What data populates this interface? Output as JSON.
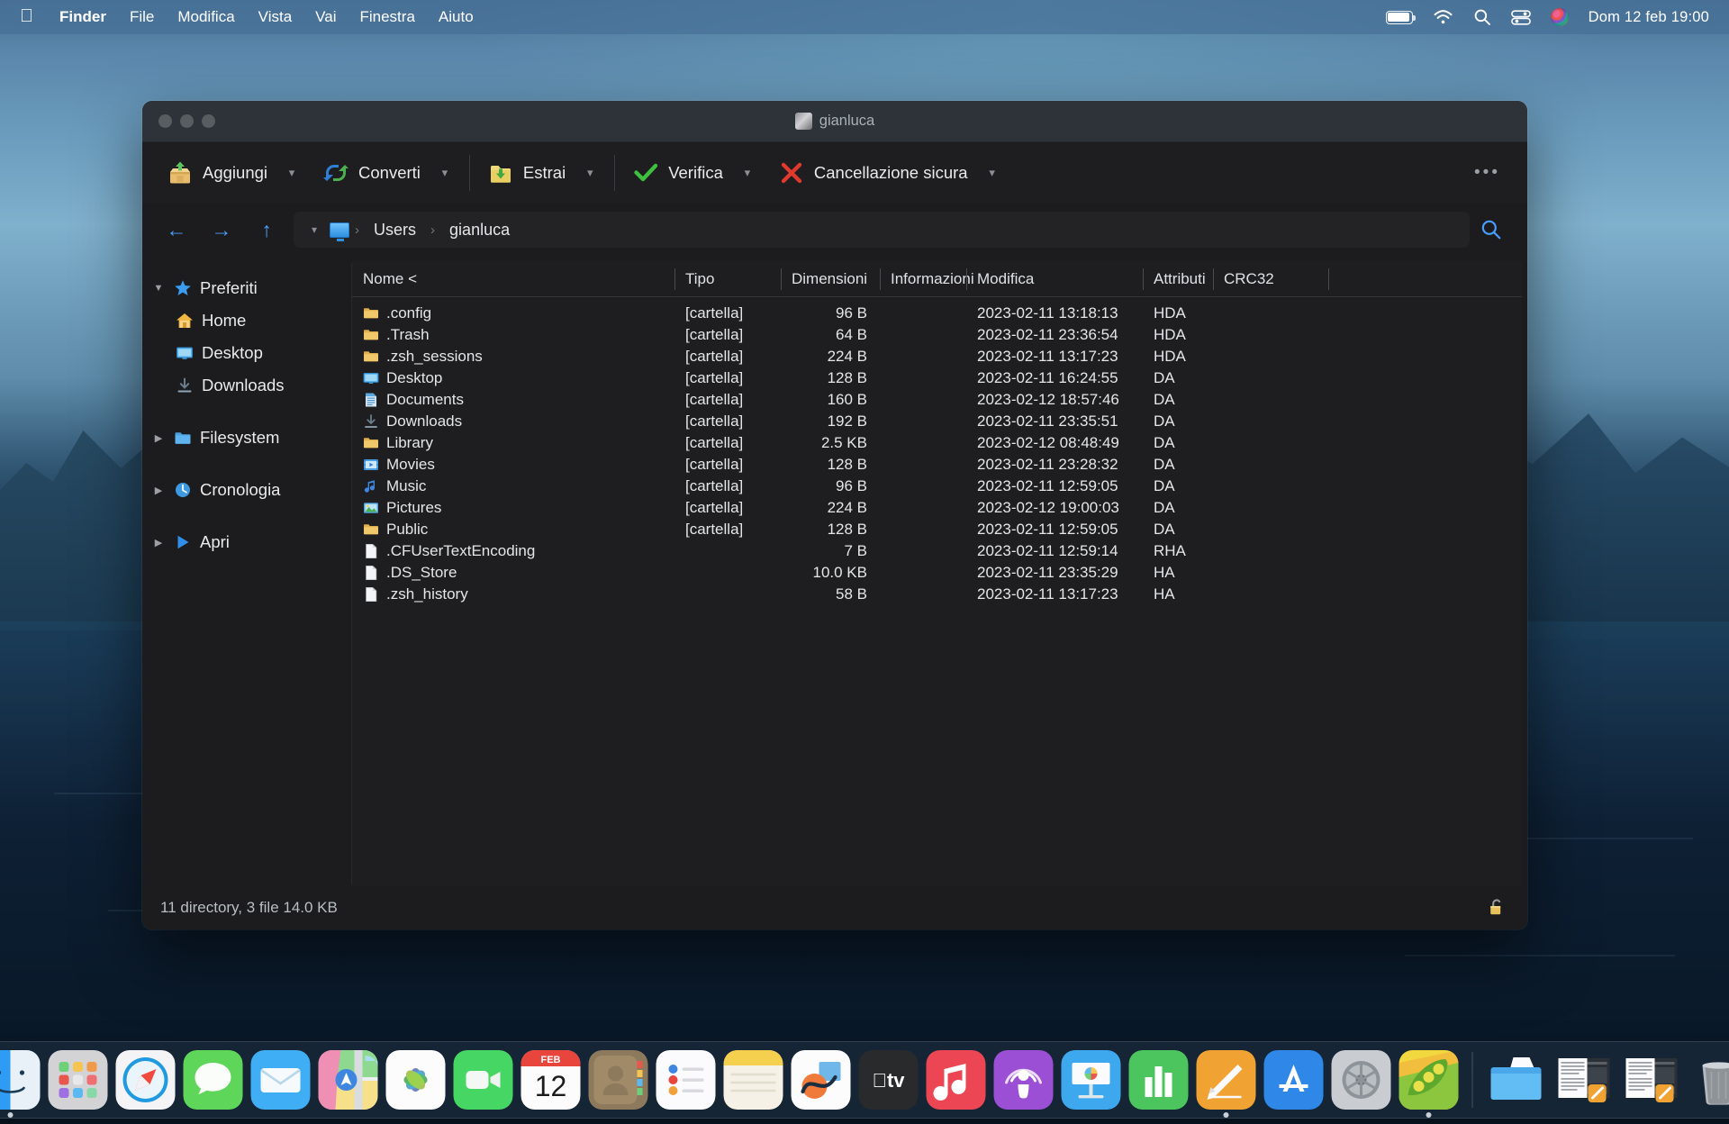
{
  "menubar": {
    "apple_icon": "apple-logo-icon",
    "items": [
      {
        "label": "Finder",
        "bold": true
      },
      {
        "label": "File",
        "bold": false
      },
      {
        "label": "Modifica",
        "bold": false
      },
      {
        "label": "Vista",
        "bold": false
      },
      {
        "label": "Vai",
        "bold": false
      },
      {
        "label": "Finestra",
        "bold": false
      },
      {
        "label": "Aiuto",
        "bold": false
      }
    ],
    "status_icons": [
      "battery-icon",
      "wifi-icon",
      "search-icon",
      "control-center-icon",
      "globe-icon"
    ],
    "clock": "Dom 12 feb  19:00"
  },
  "window": {
    "title": "gianluca",
    "traffic_lights": [
      "close-button",
      "minimize-button",
      "zoom-button"
    ],
    "toolbar": {
      "buttons": [
        {
          "label": "Aggiungi",
          "icon": "add-to-archive-icon",
          "has_menu": true
        },
        {
          "label": "Converti",
          "icon": "convert-icon",
          "has_menu": true
        },
        {
          "label": "Estrai",
          "icon": "extract-icon",
          "has_menu": true
        },
        {
          "label": "Verifica",
          "icon": "verify-checkmark-icon",
          "has_menu": true
        },
        {
          "label": "Cancellazione sicura",
          "icon": "secure-delete-x-icon",
          "has_menu": true
        }
      ],
      "overflow_label": "•••"
    },
    "pathbar": {
      "back_icon": "back-arrow-icon",
      "forward_icon": "forward-arrow-icon",
      "up_icon": "up-arrow-icon",
      "dropdown_icon": "chevron-down-icon",
      "root_icon": "display-icon",
      "separator": "›",
      "segments": [
        "Users",
        "gianluca"
      ],
      "search_icon": "search-icon"
    },
    "sidebar": {
      "groups": [
        {
          "label": "Preferiti",
          "icon": "star-icon",
          "expanded": true,
          "triangle": "▼",
          "children": [
            {
              "label": "Home",
              "icon": "home-icon"
            },
            {
              "label": "Desktop",
              "icon": "desktop-icon"
            },
            {
              "label": "Downloads",
              "icon": "downloads-icon"
            }
          ]
        },
        {
          "label": "Filesystem",
          "icon": "folder-icon",
          "expanded": false,
          "triangle": "▶",
          "children": []
        },
        {
          "label": "Cronologia",
          "icon": "clock-icon",
          "expanded": false,
          "triangle": "▶",
          "children": []
        },
        {
          "label": "Apri",
          "icon": "play-icon",
          "expanded": false,
          "triangle": "▶",
          "children": []
        }
      ]
    },
    "filelist": {
      "columns": [
        "Nome <",
        "Tipo",
        "Dimensioni",
        "Informazioni",
        "Modifica",
        "Attributi",
        "CRC32"
      ],
      "sort_indicator": "<",
      "rows": [
        {
          "icon": "folder-icon",
          "name": ".config",
          "type": "[cartella]",
          "size": "96 B",
          "info": "",
          "modified": "2023-02-11 13:18:13",
          "attributes": "HDA",
          "crc32": ""
        },
        {
          "icon": "folder-icon",
          "name": ".Trash",
          "type": "[cartella]",
          "size": "64 B",
          "info": "",
          "modified": "2023-02-11 23:36:54",
          "attributes": "HDA",
          "crc32": ""
        },
        {
          "icon": "folder-icon",
          "name": ".zsh_sessions",
          "type": "[cartella]",
          "size": "224 B",
          "info": "",
          "modified": "2023-02-11 13:17:23",
          "attributes": "HDA",
          "crc32": ""
        },
        {
          "icon": "desktop-icon",
          "name": "Desktop",
          "type": "[cartella]",
          "size": "128 B",
          "info": "",
          "modified": "2023-02-11 16:24:55",
          "attributes": "DA",
          "crc32": ""
        },
        {
          "icon": "documents-icon",
          "name": "Documents",
          "type": "[cartella]",
          "size": "160 B",
          "info": "",
          "modified": "2023-02-12 18:57:46",
          "attributes": "DA",
          "crc32": ""
        },
        {
          "icon": "downloads-icon",
          "name": "Downloads",
          "type": "[cartella]",
          "size": "192 B",
          "info": "",
          "modified": "2023-02-11 23:35:51",
          "attributes": "DA",
          "crc32": ""
        },
        {
          "icon": "folder-icon",
          "name": "Library",
          "type": "[cartella]",
          "size": "2.5 KB",
          "info": "",
          "modified": "2023-02-12 08:48:49",
          "attributes": "DA",
          "crc32": ""
        },
        {
          "icon": "movies-icon",
          "name": "Movies",
          "type": "[cartella]",
          "size": "128 B",
          "info": "",
          "modified": "2023-02-11 23:28:32",
          "attributes": "DA",
          "crc32": ""
        },
        {
          "icon": "music-icon",
          "name": "Music",
          "type": "[cartella]",
          "size": "96 B",
          "info": "",
          "modified": "2023-02-11 12:59:05",
          "attributes": "DA",
          "crc32": ""
        },
        {
          "icon": "pictures-icon",
          "name": "Pictures",
          "type": "[cartella]",
          "size": "224 B",
          "info": "",
          "modified": "2023-02-12 19:00:03",
          "attributes": "DA",
          "crc32": ""
        },
        {
          "icon": "folder-icon",
          "name": "Public",
          "type": "[cartella]",
          "size": "128 B",
          "info": "",
          "modified": "2023-02-11 12:59:05",
          "attributes": "DA",
          "crc32": ""
        },
        {
          "icon": "file-icon",
          "name": ".CFUserTextEncoding",
          "type": "",
          "size": "7 B",
          "info": "",
          "modified": "2023-02-11 12:59:14",
          "attributes": "RHA",
          "crc32": ""
        },
        {
          "icon": "file-icon",
          "name": ".DS_Store",
          "type": "",
          "size": "10.0 KB",
          "info": "",
          "modified": "2023-02-11 23:35:29",
          "attributes": "HA",
          "crc32": ""
        },
        {
          "icon": "file-icon",
          "name": ".zsh_history",
          "type": "",
          "size": "58 B",
          "info": "",
          "modified": "2023-02-11 13:17:23",
          "attributes": "HA",
          "crc32": ""
        }
      ]
    },
    "statusbar": {
      "text": "11 directory, 3 file 14.0 KB",
      "lock_icon": "unlocked-padlock-icon"
    }
  },
  "dock": {
    "items": [
      {
        "name": "finder",
        "running": true
      },
      {
        "name": "launchpad",
        "running": false
      },
      {
        "name": "safari",
        "running": false
      },
      {
        "name": "messages",
        "running": false
      },
      {
        "name": "mail",
        "running": false
      },
      {
        "name": "maps",
        "running": false
      },
      {
        "name": "photos",
        "running": false
      },
      {
        "name": "facetime",
        "running": false
      },
      {
        "name": "calendar",
        "running": false
      },
      {
        "name": "contacts",
        "running": false
      },
      {
        "name": "reminders",
        "running": false
      },
      {
        "name": "notes",
        "running": false
      },
      {
        "name": "freeform",
        "running": false
      },
      {
        "name": "appletv",
        "running": false
      },
      {
        "name": "music",
        "running": false
      },
      {
        "name": "podcasts",
        "running": false
      },
      {
        "name": "keynote",
        "running": false
      },
      {
        "name": "numbers",
        "running": false
      },
      {
        "name": "pages",
        "running": true
      },
      {
        "name": "appstore",
        "running": false
      },
      {
        "name": "system-settings",
        "running": false
      },
      {
        "name": "keka",
        "running": true
      },
      {
        "name": "separator",
        "running": false
      },
      {
        "name": "downloads-folder",
        "running": false
      },
      {
        "name": "document-stack-1",
        "running": false
      },
      {
        "name": "document-stack-2",
        "running": false
      },
      {
        "name": "trash",
        "running": false
      }
    ],
    "calendar_month": "FEB",
    "calendar_day": "12",
    "appletv_label": "tv"
  },
  "colors": {
    "accent_blue": "#4a9eff",
    "window_bg": "#1c1c1e",
    "titlebar_bg": "#2d3338",
    "menubar_bg": "rgba(70,110,150,0.62)",
    "text_primary": "#e4e6e8"
  }
}
